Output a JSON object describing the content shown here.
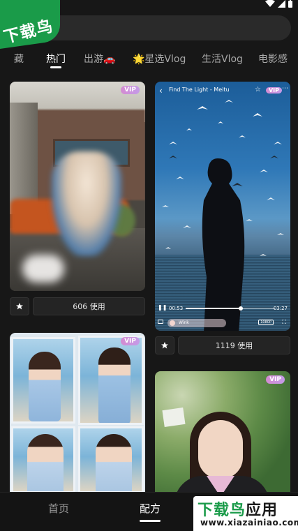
{
  "status_bar": {
    "icons": [
      "wifi-icon",
      "signal-icon",
      "battery-icon"
    ]
  },
  "watermark_top": {
    "text": "下载鸟"
  },
  "search": {
    "placeholder": ""
  },
  "tabs": [
    {
      "label": "藏",
      "active": false
    },
    {
      "label": "热门",
      "active": true
    },
    {
      "label": "出游🚗",
      "active": false
    },
    {
      "label": "🌟星选Vlog",
      "active": false
    },
    {
      "label": "生活Vlog",
      "active": false
    },
    {
      "label": "电影感",
      "active": false
    }
  ],
  "cards": [
    {
      "vip": "VIP",
      "use_label": "606 使用"
    },
    {
      "vip": "VIP",
      "player": {
        "title": "Find The Light - Meitu",
        "time_current": "00:53",
        "time_total": "03:27",
        "progress": 0.62,
        "effect_label": "Wink",
        "resolution": "1080P"
      },
      "use_label": "1119 使用"
    },
    {
      "vip": "VIP"
    },
    {
      "vip": "VIP"
    }
  ],
  "bottom_nav": {
    "items": [
      {
        "label": "首页",
        "active": false
      },
      {
        "label": "配方",
        "active": true
      }
    ]
  },
  "watermark_bottom": {
    "title_green": "下载鸟",
    "title_dark": "应用",
    "url": "www.xiazainiao.com"
  },
  "colors": {
    "background": "#171717",
    "watermark_green": "#1a9b49",
    "vip_gradient": [
      "#d48bd1",
      "#c49be8"
    ]
  }
}
